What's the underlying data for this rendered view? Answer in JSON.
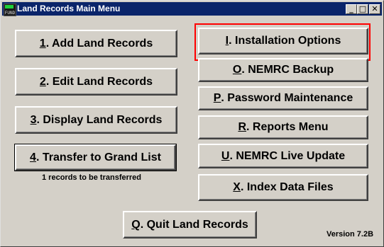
{
  "window": {
    "title": "Land Records Main Menu",
    "icon_label": "FUND",
    "icon": "fund-app-icon"
  },
  "controls": {
    "minimize": "_",
    "maximize": "□",
    "close": "✕"
  },
  "left_buttons": [
    {
      "key": "1",
      "label": ". Add Land Records"
    },
    {
      "key": "2",
      "label": ". Edit Land Records"
    },
    {
      "key": "3",
      "label": ". Display Land Records"
    },
    {
      "key": "4",
      "label": ". Transfer to Grand List"
    }
  ],
  "transfer_note": "1 records to be transferred",
  "right_buttons": [
    {
      "key": "I",
      "label": ". Installation Options"
    },
    {
      "key": "O",
      "label": ". NEMRC Backup"
    },
    {
      "key": "P",
      "label": ". Password Maintenance"
    },
    {
      "key": "R",
      "label": ". Reports Menu"
    },
    {
      "key": "U",
      "label": ". NEMRC Live Update"
    },
    {
      "key": "X",
      "label": ".  Index Data Files"
    }
  ],
  "quit_button": {
    "key": "Q",
    "label": ". Quit Land Records"
  },
  "version": "Version 7.2B",
  "colors": {
    "titlebar": "#0a246a",
    "face": "#d4d0c8",
    "highlight": "#ff0000"
  }
}
